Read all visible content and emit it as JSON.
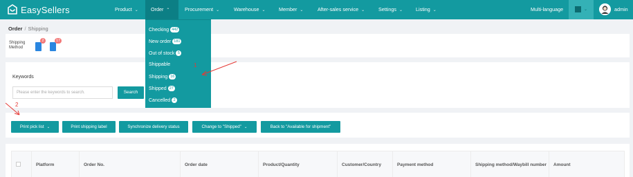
{
  "app": {
    "logo_text": "EasySellers"
  },
  "colors": {
    "primary": "#139aa0",
    "primary_dark": "#0c7f85",
    "badge_red": "#f27878",
    "annotation": "#e53935"
  },
  "nav": {
    "items": [
      {
        "label": "Product"
      },
      {
        "label": "Order",
        "expanded": true
      },
      {
        "label": "Procurement"
      },
      {
        "label": "Warehouse"
      },
      {
        "label": "Member"
      },
      {
        "label": "After-sales service"
      },
      {
        "label": "Settings"
      },
      {
        "label": "Listing"
      }
    ],
    "language": "Multi-language",
    "user": "admin"
  },
  "order_menu": {
    "items": [
      {
        "label": "Checking",
        "count": "442"
      },
      {
        "label": "New order",
        "count": "181"
      },
      {
        "label": "Out of stock",
        "count": "5"
      },
      {
        "label": "Shippable",
        "count": ""
      },
      {
        "label": "Shipping",
        "count": "16"
      },
      {
        "label": "Shipped",
        "count": "27"
      },
      {
        "label": "Cancelled",
        "count": "2"
      }
    ]
  },
  "breadcrumb": {
    "root": "Order",
    "separator": "/",
    "current": "Shipping"
  },
  "shipping_method": {
    "label": "Shipping Method",
    "counts": [
      "2",
      "17"
    ]
  },
  "search": {
    "label": "Keywords",
    "placeholder": "Please enter the keywords to search.",
    "button": "Search"
  },
  "actions": {
    "print_pick_list": "Print pick list",
    "print_shipping_label": "Print shipping label",
    "sync_delivery": "Synchronize delivery status",
    "change_shipped": "Change to \"Shipped\"",
    "back_available": "Back to \"Available for shipment\""
  },
  "table": {
    "columns": [
      "Platform",
      "Order No.",
      "Order date",
      "Product/Quantity",
      "Customer/Country",
      "Payment method",
      "Shipping method/Waybill number",
      "Amount"
    ]
  },
  "annotations": {
    "marker_1": "1",
    "marker_2": "2"
  }
}
